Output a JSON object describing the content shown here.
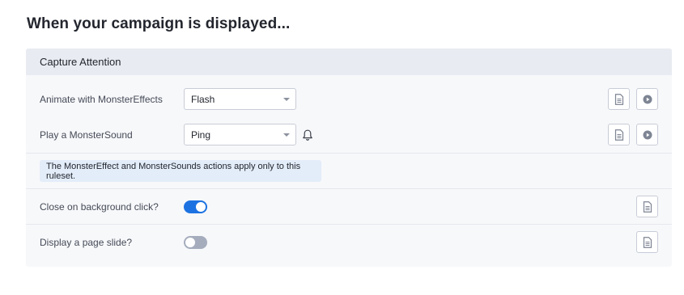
{
  "page": {
    "title": "When your campaign is displayed..."
  },
  "panel": {
    "header": "Capture Attention"
  },
  "effects_row": {
    "label": "Animate with MonsterEffects",
    "selected": "Flash"
  },
  "sound_row": {
    "label": "Play a MonsterSound",
    "selected": "Ping"
  },
  "notice": {
    "text": "The MonsterEffect and MonsterSounds actions apply only to this ruleset."
  },
  "close_row": {
    "label": "Close on background click?",
    "enabled": true
  },
  "slide_row": {
    "label": "Display a page slide?",
    "enabled": false
  },
  "colors": {
    "toggle_on": "#1d72e2",
    "toggle_off": "#a5adbd",
    "notice_bg": "#e3edf9",
    "header_bg": "#e8ebf1",
    "panel_bg": "#f7f8fa"
  },
  "icons": {
    "doc": "document-icon",
    "play": "play-icon",
    "bell": "bell-icon"
  }
}
